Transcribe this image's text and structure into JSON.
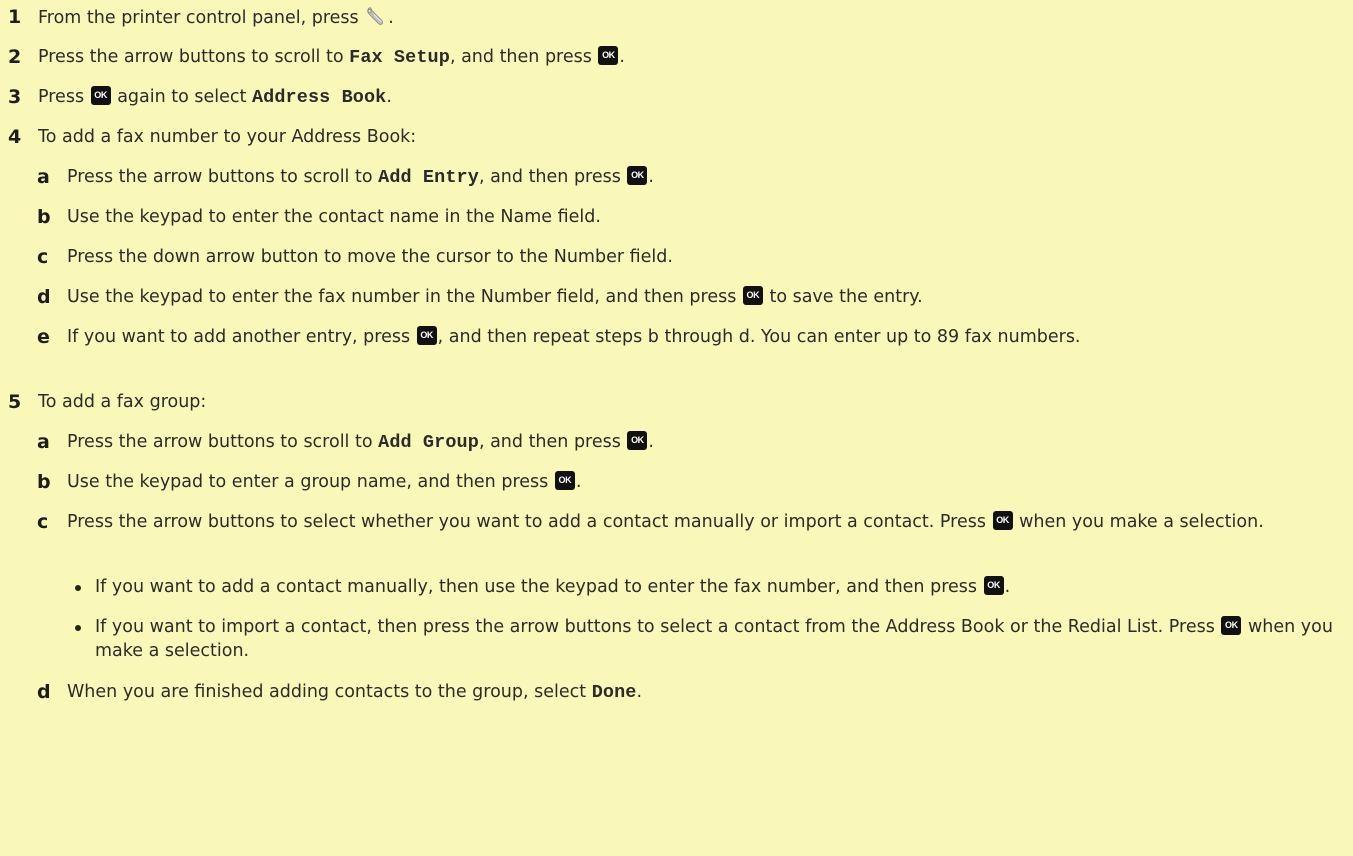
{
  "ok_label": "OK",
  "steps": {
    "s1": {
      "num": "1",
      "pre": "From the printer control panel, press ",
      "post": "."
    },
    "s2": {
      "num": "2",
      "pre": "Press the arrow buttons to scroll to ",
      "code": "Fax Setup",
      "mid": ", and then press ",
      "post": "."
    },
    "s3": {
      "num": "3",
      "pre": "Press ",
      "mid": " again to select ",
      "code": "Address Book",
      "post": "."
    },
    "s4": {
      "num": "4",
      "text": "To add a fax number to your Address Book:",
      "a": {
        "letter": "a",
        "pre": "Press the arrow buttons to scroll to ",
        "code": "Add Entry",
        "mid": ", and then press ",
        "post": "."
      },
      "b": {
        "letter": "b",
        "text": "Use the keypad to enter the contact name in the Name field."
      },
      "c": {
        "letter": "c",
        "text": "Press the down arrow button to move the cursor to the Number field."
      },
      "d": {
        "letter": "d",
        "pre": "Use the keypad to enter the fax number in the Number field, and then press ",
        "post": " to save the entry."
      },
      "e": {
        "letter": "e",
        "pre": "If you want to add another entry, press ",
        "post": ", and then repeat steps b through d. You can enter up to 89 fax numbers."
      }
    },
    "s5": {
      "num": "5",
      "text": "To add a fax group:",
      "a": {
        "letter": "a",
        "pre": "Press the arrow buttons to scroll to ",
        "code": "Add Group",
        "mid": ", and then press ",
        "post": "."
      },
      "b": {
        "letter": "b",
        "pre": "Use the keypad to enter a group name, and then press ",
        "post": "."
      },
      "c": {
        "letter": "c",
        "pre": "Press the arrow buttons to select whether you want to add a contact manually or import a contact. Press ",
        "post": " when you make a selection.",
        "bullet1": {
          "pre": "If you want to add a contact manually, then use the keypad to enter the fax number, and then press ",
          "post": "."
        },
        "bullet2": {
          "pre": "If you want to import a contact, then press the arrow buttons to select a contact from the Address Book or the Redial List. Press ",
          "post": " when you make a selection."
        }
      },
      "d": {
        "letter": "d",
        "pre": "When you are finished adding contacts to the group, select ",
        "code": "Done",
        "post": "."
      }
    }
  }
}
